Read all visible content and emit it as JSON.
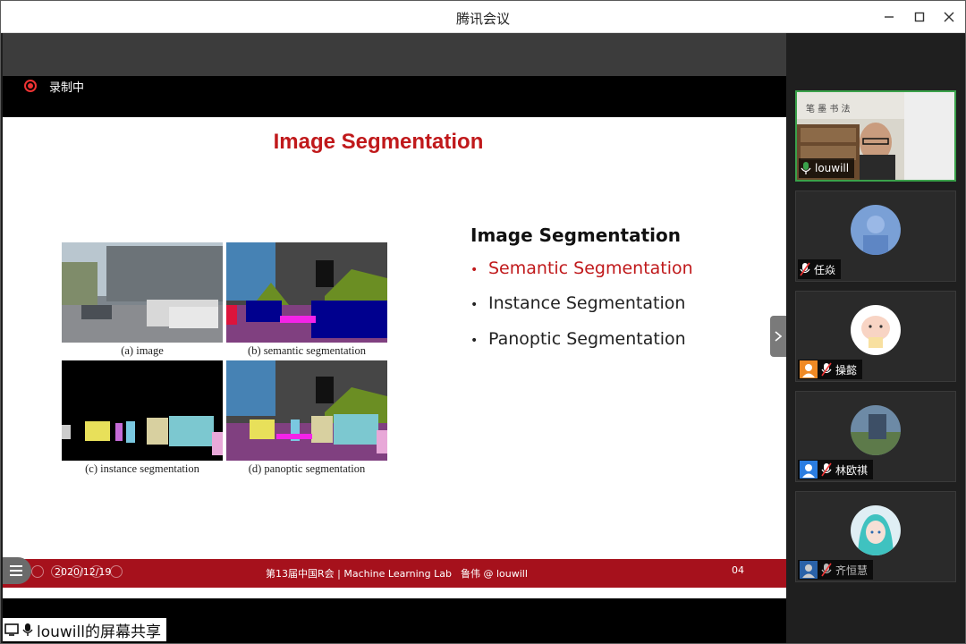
{
  "window": {
    "title": "腾讯会议"
  },
  "recording": {
    "label": "录制中"
  },
  "slide": {
    "title": "Image Segmentation",
    "figures": {
      "a": "(a) image",
      "b": "(b) semantic segmentation",
      "c": "(c) instance segmentation",
      "d": "(d) panoptic segmentation"
    },
    "list_title": "Image Segmentation",
    "items": [
      "Semantic Segmentation",
      "Instance Segmentation",
      "Panoptic Segmentation"
    ],
    "footer": {
      "date": "2020/12/19",
      "event": "第13届中国R会 | Machine Learning Lab",
      "author": "鲁伟 @ louwill",
      "page": "04"
    }
  },
  "sharer": {
    "label": "louwill的屏幕共享"
  },
  "participants": [
    {
      "name": "louwill",
      "mic": "on"
    },
    {
      "name": "任焱",
      "mic": "muted"
    },
    {
      "name": "操懿",
      "mic": "muted"
    },
    {
      "name": "林欧祺",
      "mic": "muted"
    },
    {
      "name": "齐恒慧",
      "mic": "muted"
    }
  ],
  "colors": {
    "accent": "#c0191b",
    "footer": "#a6111c",
    "speaking": "#3aa14a",
    "user_badge_orange": "#f08a24",
    "user_badge_blue": "#2a7de1"
  }
}
